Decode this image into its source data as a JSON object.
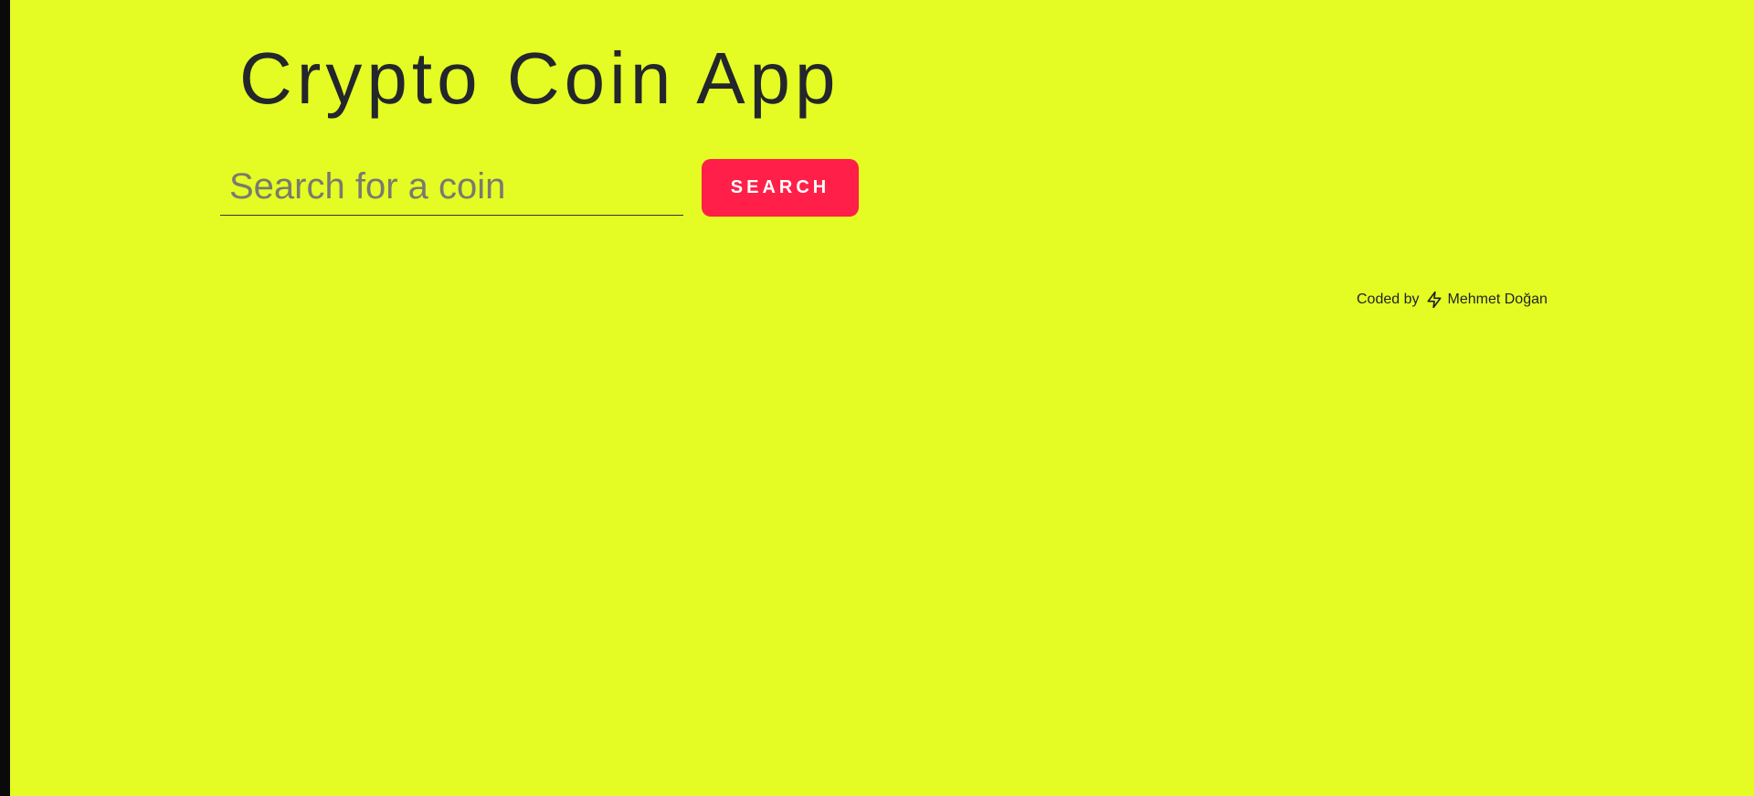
{
  "app": {
    "title": "Crypto Coin App"
  },
  "search": {
    "placeholder": "Search for a coin",
    "value": "",
    "button_label": "Search"
  },
  "footer": {
    "coded_by_label": "Coded by",
    "icon": "lightning-bolt-icon",
    "author": "Mehmet Doğan"
  },
  "colors": {
    "background": "#e4fc23",
    "accent": "#ff1f48",
    "text": "#23262b"
  }
}
